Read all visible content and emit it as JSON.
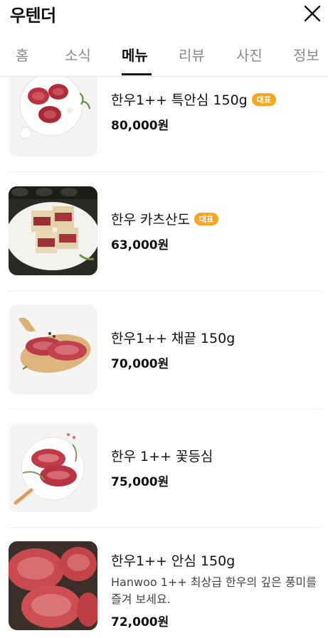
{
  "header": {
    "title": "우텐더"
  },
  "tabs": [
    "홈",
    "소식",
    "메뉴",
    "리뷰",
    "사진",
    "정보"
  ],
  "active_tab": "메뉴",
  "menu": [
    {
      "name": "한우1++ 특안심 150g",
      "badge": "대표",
      "price": "80,000원"
    },
    {
      "name": "한우 카츠산도",
      "badge": "대표",
      "price": "63,000원"
    },
    {
      "name": "한우1++ 채끝 150g",
      "price": "70,000원"
    },
    {
      "name": "한우 1++ 꽃등심",
      "price": "75,000원"
    },
    {
      "name": "한우1++ 안심 150g",
      "description": "Hanwoo 1++ 최상급 한우의 깊은 풍미를 즐겨 보세요.",
      "price": "72,000원"
    }
  ],
  "colors": {
    "badge": "#f5a623",
    "active_tab": "#111111",
    "inactive_tab": "#8a8a8a"
  }
}
